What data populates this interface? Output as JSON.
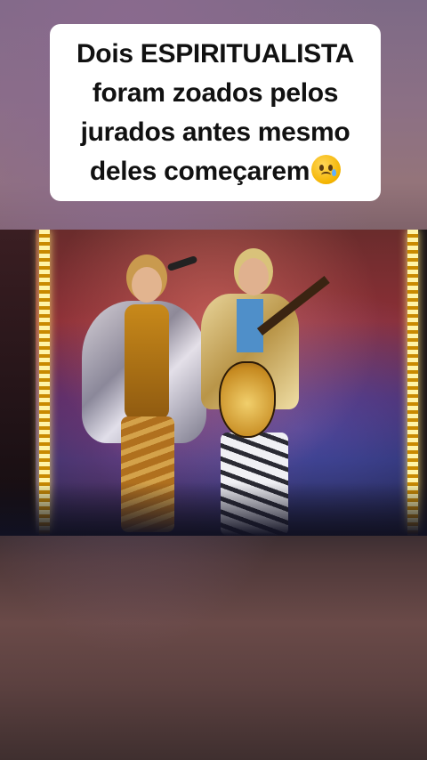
{
  "caption": {
    "lines": [
      "Dois ESPIRITUALISTA",
      "foram zoados pelos",
      "jurados antes mesmo",
      "deles começarem"
    ],
    "emoji": "disappointed-but-relieved-emoji"
  },
  "video": {
    "description_icon": "stage-performance-photo"
  },
  "colors": {
    "caption_bg": "#ffffff",
    "caption_text": "#111111",
    "bulb_light": "#fff4a8"
  }
}
